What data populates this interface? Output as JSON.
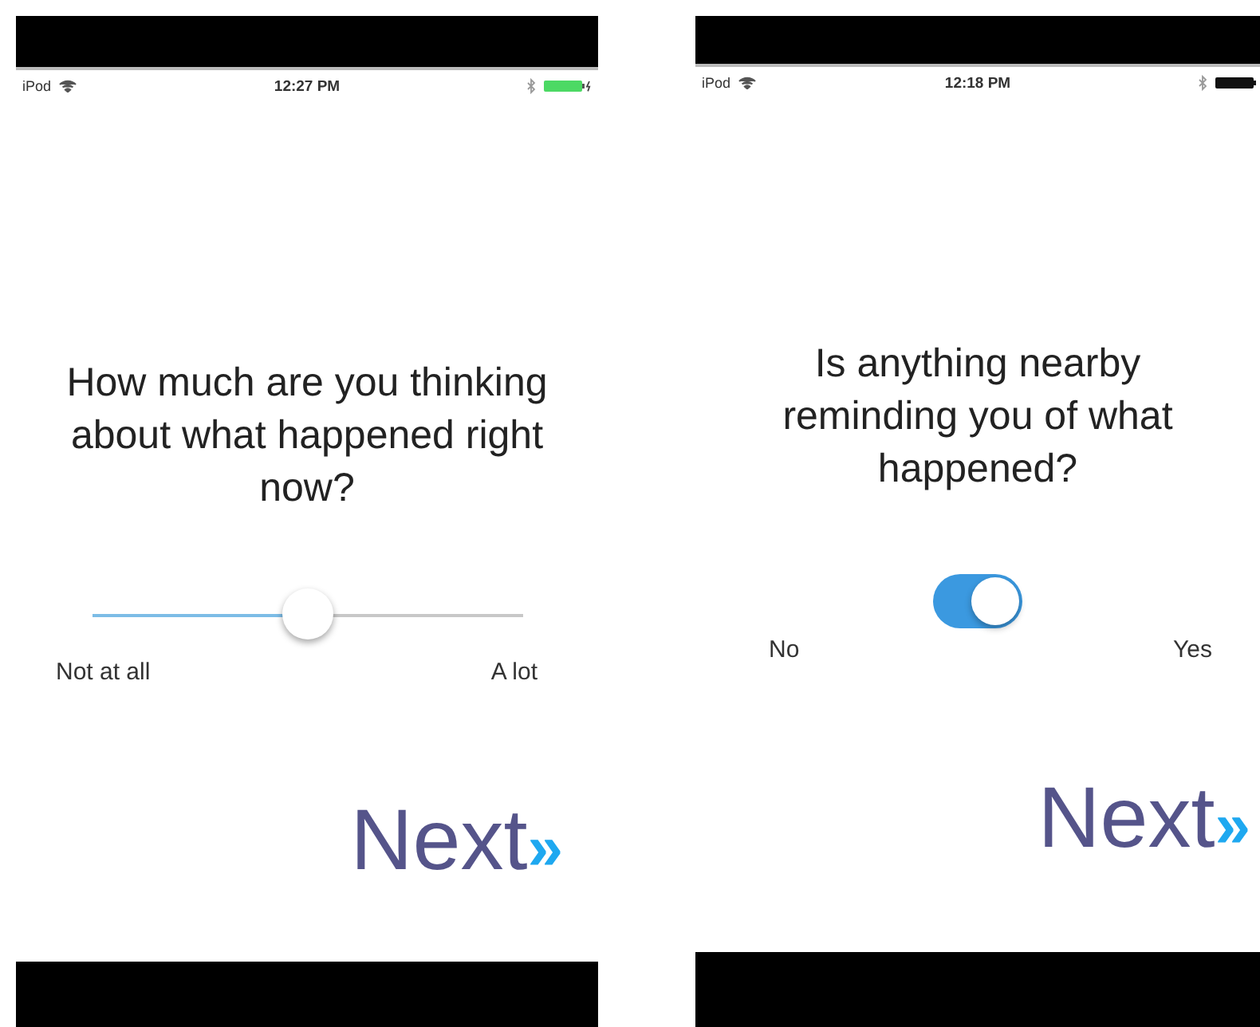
{
  "screens": [
    {
      "status_bar": {
        "carrier": "iPod",
        "time": "12:27 PM"
      },
      "question": "How much are you thinking about what happened right now?",
      "kind": "slider",
      "level": 0.5,
      "min_label": "Not at all",
      "max_label": "A lot",
      "next_label": "Next",
      "next_chevron": "»"
    },
    {
      "status_bar": {
        "carrier": "iPod",
        "time": "12:18 PM"
      },
      "question": "Is anything nearby reminding you of what happened?",
      "kind": "toggle",
      "on": true,
      "min_label": "No",
      "max_label": "Yes",
      "next_label": "Next",
      "next_chevron": "»"
    }
  ]
}
